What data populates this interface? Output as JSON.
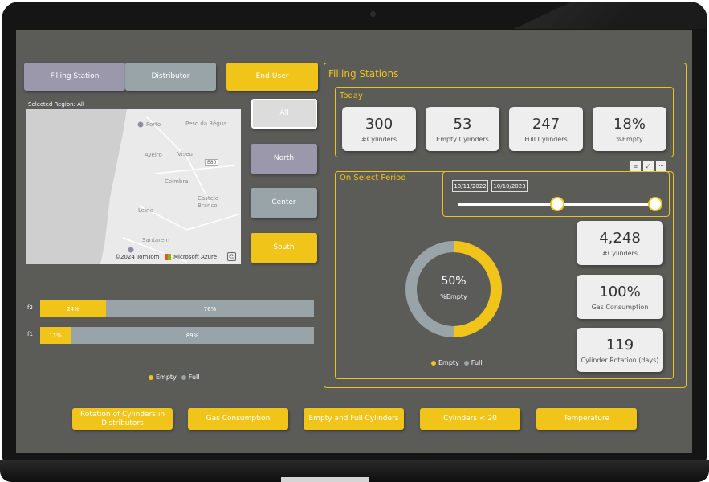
{
  "colors": {
    "accent": "#f0c419",
    "full": "#98a4a8",
    "lavender": "#9a98aa",
    "screen_bg": "#5b5b58"
  },
  "top_buttons": {
    "filling_station": "Filling Station",
    "distributor": "Distributor",
    "end_user": "End-User"
  },
  "map": {
    "selected_region": "Selected Region: All",
    "places": [
      "Porto",
      "Peso da Régua",
      "Aveiro",
      "Viseu",
      "Coimbra",
      "Castelo Branco",
      "Leiria",
      "Santarem"
    ],
    "road_marker": "E80",
    "copyright": "©2024 TomTom",
    "provider": "Microsoft Azure"
  },
  "regions": {
    "all": "All",
    "north": "North",
    "center": "Center",
    "south": "South"
  },
  "bars": [
    {
      "label": "f2",
      "empty_label": "24%",
      "full_label": "76%",
      "empty_fraction": 0.24
    },
    {
      "label": "f1",
      "empty_label": "11%",
      "full_label": "89%",
      "empty_fraction": 0.11
    }
  ],
  "left_legend": {
    "empty": "Empty",
    "full": "Full"
  },
  "filling_stations": {
    "title": "Filling Stations",
    "today": {
      "title": "Today",
      "kpis": [
        {
          "value": "300",
          "label": "#Cylinders"
        },
        {
          "value": "53",
          "label": "Empty Cylinders"
        },
        {
          "value": "247",
          "label": "Full Cylinders"
        },
        {
          "value": "18%",
          "label": "%Empty"
        }
      ]
    },
    "period": {
      "title": "On Select Period",
      "date_start": "10/11/2022",
      "date_end": "10/10/2023",
      "toolbar": {
        "filter": "filter-icon",
        "focus": "focus-mode-icon",
        "more": "more-options-icon"
      },
      "donut": {
        "value": "50%",
        "label": "%Empty",
        "empty_fraction": 0.5
      },
      "legend": {
        "empty": "Empty",
        "full": "Full"
      },
      "kpis": [
        {
          "value": "4,248",
          "label": "#Cylinders"
        },
        {
          "value": "100%",
          "label": "Gas Consumption"
        },
        {
          "value": "119",
          "label": "Cylinder Rotation (days)"
        }
      ]
    }
  },
  "bottom_buttons": {
    "rotation": "Rotation of Cylinders in Distributors",
    "gas": "Gas Consumption",
    "empty_full": "Empty and Full Cylinders",
    "cyl20": "Cylinders < 20",
    "temperature": "Temperature"
  }
}
